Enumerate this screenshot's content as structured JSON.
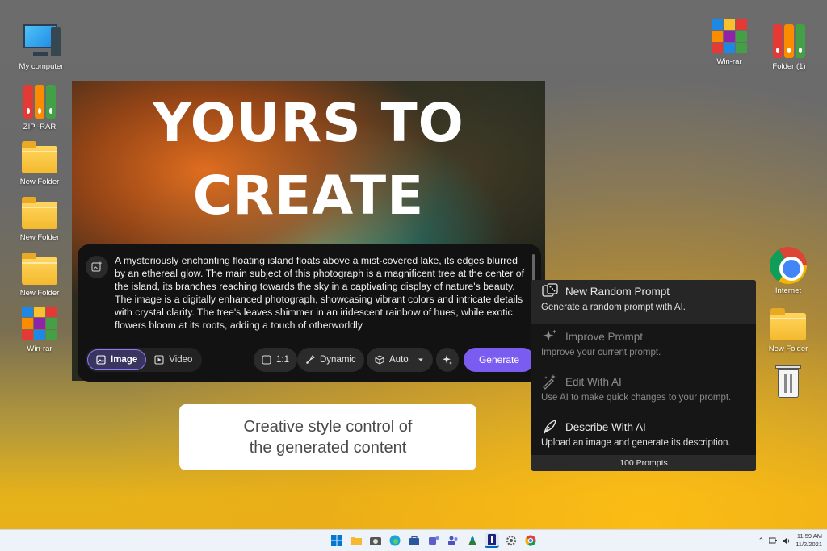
{
  "desktop": {
    "left_icons": [
      {
        "label": "My computer",
        "icon": "computer-icon"
      },
      {
        "label": "ZIP -RAR",
        "icon": "zip-binders-icon"
      },
      {
        "label": "New Folder",
        "icon": "folder-icon"
      },
      {
        "label": "New Folder",
        "icon": "folder-icon"
      },
      {
        "label": "New Folder",
        "icon": "folder-icon"
      },
      {
        "label": "Win-rar",
        "icon": "winrar-icon"
      }
    ],
    "right_icons": [
      {
        "label": "Win-rar",
        "icon": "winrar-icon"
      },
      {
        "label": "Folder (1)",
        "icon": "zip-binders-icon"
      },
      {
        "label": "Internet",
        "icon": "chrome-icon"
      },
      {
        "label": "New Folder",
        "icon": "folder-icon"
      },
      {
        "label": "",
        "icon": "recycle-bin-icon"
      }
    ]
  },
  "hero": {
    "title_line1": "YOURS TO",
    "title_line2": "CREATE"
  },
  "prompt": {
    "text": "A mysteriously enchanting floating island floats above a mist-covered lake, its edges blurred by an ethereal glow. The main subject of this photograph is a magnificent tree at the center of the island, its branches reaching towards the sky in a captivating display of nature's beauty. The image is a digitally enhanced photograph, showcasing vibrant colors and intricate details with crystal clarity. The tree's leaves shimmer in an iridescent rainbow of hues, while exotic flowers bloom at its roots, adding a touch of otherworldly",
    "mode_image": "Image",
    "mode_video": "Video",
    "aspect_ratio": "1:1",
    "style": "Dynamic",
    "model": "Auto",
    "generate_label": "Generate"
  },
  "menu": {
    "items": [
      {
        "title": "New Random Prompt",
        "desc": "Generate a random prompt with AI."
      },
      {
        "title": "Improve Prompt",
        "desc": "Improve your current prompt."
      },
      {
        "title": "Edit With AI",
        "desc": "Use AI to make quick changes to your prompt."
      },
      {
        "title": "Describe With AI",
        "desc": "Upload an image and generate its description."
      }
    ],
    "footer": "100 Prompts"
  },
  "caption": {
    "line1": "Creative style control of",
    "line2": "the generated content"
  },
  "taskbar": {
    "time": "11:59 AM",
    "date": "11/2/2021"
  },
  "colors": {
    "accent": "#7b5cf0",
    "menu_bg": "#161616",
    "prompt_bg": "#121212"
  }
}
